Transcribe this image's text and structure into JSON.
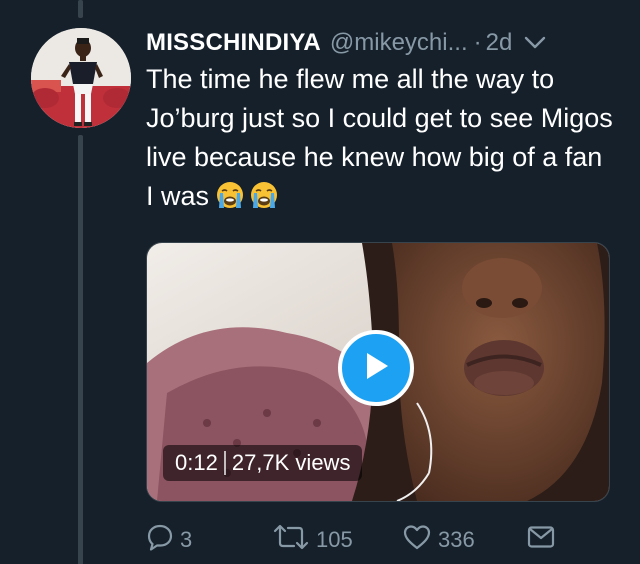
{
  "tweet": {
    "display_name": "MISSCHINDIYA",
    "handle": "@mikeychi...",
    "separator": "·",
    "time": "2d",
    "text": "The time he flew me all the way to Jo’burg just so I could get to see Migos live because he knew how big of a fan I was",
    "emojis": [
      "loudly-crying-face",
      "loudly-crying-face"
    ]
  },
  "video": {
    "duration": "0:12",
    "views": "27,7K views"
  },
  "actions": {
    "replies": "3",
    "retweets": "105",
    "likes": "336"
  },
  "colors": {
    "background": "#15202b",
    "secondary_text": "#8899a6",
    "accent": "#1da1f2",
    "thread_line": "#38444d"
  }
}
